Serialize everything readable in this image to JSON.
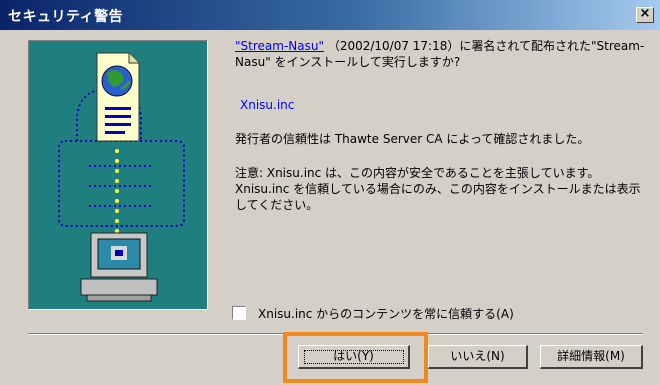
{
  "window": {
    "title": "セキュリティ警告",
    "close_glyph": "×"
  },
  "body": {
    "link_text": "\"Stream-Nasu\"",
    "prompt_text": "（2002/10/07 17:18）に署名されて配布された\"Stream-Nasu\" をインストールして実行しますか?",
    "publisher": "Xnisu.inc",
    "issued_text": "発行者の信頼性は Thawte Server CA によって確認されました。",
    "warning_text": "注意: Xnisu.inc は、この内容が安全であることを主張しています。Xnisu.inc を信頼している場合にのみ、この内容をインストールまたは表示してください。"
  },
  "checkbox": {
    "label": "Xnisu.inc からのコンテンツを常に信頼する(A)"
  },
  "buttons": {
    "yes": "はい(Y)",
    "no": "いいえ(N)",
    "detail": "詳細情報(M)"
  },
  "colors": {
    "title_gradient_start": "#0a246a",
    "art_background": "#1f7f7f",
    "link": "#0000ee",
    "highlight": "#f08a1c"
  },
  "icons": {
    "art": [
      "document-icon",
      "globe-icon",
      "padlock-icon",
      "computer-icon"
    ]
  }
}
